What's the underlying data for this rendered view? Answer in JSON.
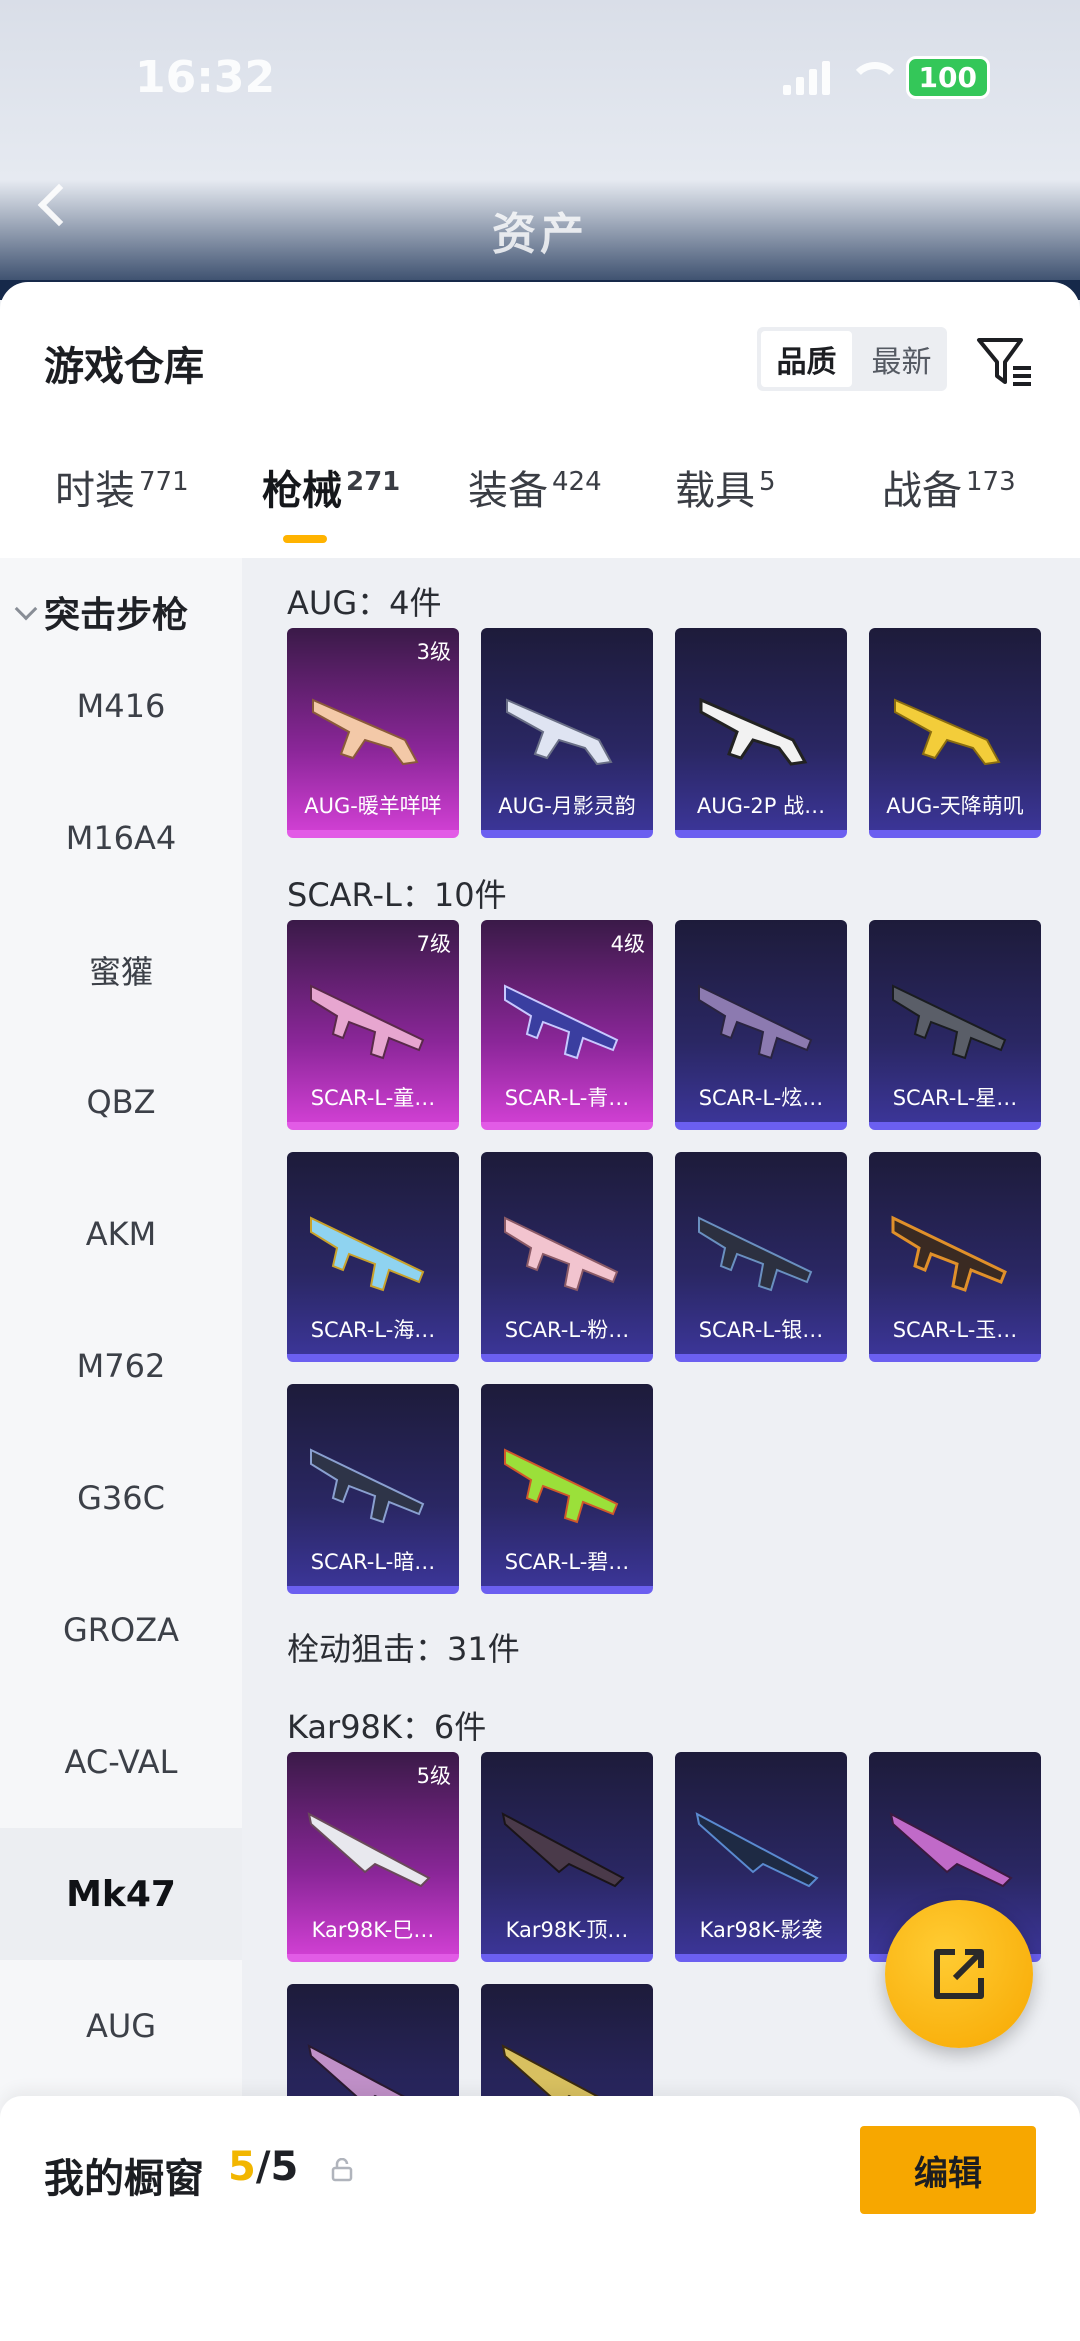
{
  "status": {
    "time": "16:32",
    "battery": "100"
  },
  "nav": {
    "title": "资产"
  },
  "header": {
    "title": "游戏仓库",
    "sort_options": [
      "品质",
      "最新"
    ]
  },
  "tabs": [
    {
      "label": "时装",
      "count": "771"
    },
    {
      "label": "枪械",
      "count": "271"
    },
    {
      "label": "装备",
      "count": "424"
    },
    {
      "label": "载具",
      "count": "5"
    },
    {
      "label": "战备",
      "count": "173"
    }
  ],
  "sidebar": {
    "group": "突击步枪",
    "items": [
      "M416",
      "M16A4",
      "蜜獾",
      "QBZ",
      "AKM",
      "M762",
      "G36C",
      "GROZA",
      "AC-VAL",
      "Mk47",
      "AUG"
    ]
  },
  "sections": {
    "aug": {
      "title": "AUG：4件",
      "items": [
        {
          "name": "AUG-暖羊咩咩",
          "level": "3级"
        },
        {
          "name": "AUG-月影灵韵",
          "level": ""
        },
        {
          "name": "AUG-2P 战…",
          "level": ""
        },
        {
          "name": "AUG-天降萌叽",
          "level": ""
        }
      ]
    },
    "scar": {
      "title": "SCAR-L：10件",
      "items": [
        {
          "name": "SCAR-L-童…",
          "level": "7级"
        },
        {
          "name": "SCAR-L-青…",
          "level": "4级"
        },
        {
          "name": "SCAR-L-炫…",
          "level": ""
        },
        {
          "name": "SCAR-L-星…",
          "level": ""
        },
        {
          "name": "SCAR-L-海…",
          "level": ""
        },
        {
          "name": "SCAR-L-粉…",
          "level": ""
        },
        {
          "name": "SCAR-L-银…",
          "level": ""
        },
        {
          "name": "SCAR-L-玉…",
          "level": ""
        },
        {
          "name": "SCAR-L-暗…",
          "level": ""
        },
        {
          "name": "SCAR-L-碧…",
          "level": ""
        }
      ]
    },
    "bolt": {
      "title": "栓动狙击：31件"
    },
    "kar": {
      "title": "Kar98K：6件",
      "items": [
        {
          "name": "Kar98K-巳…",
          "level": "5级"
        },
        {
          "name": "Kar98K-顶…",
          "level": ""
        },
        {
          "name": "Kar98K-影袭",
          "level": ""
        },
        {
          "name": "",
          "level": ""
        }
      ]
    }
  },
  "bottom": {
    "label": "我的橱窗",
    "current": "5",
    "total": "/5",
    "edit": "编辑"
  },
  "colors": {
    "accent": "#f7a700",
    "rare_card": "#cf3fd2",
    "epic_card": "#3b3597"
  }
}
